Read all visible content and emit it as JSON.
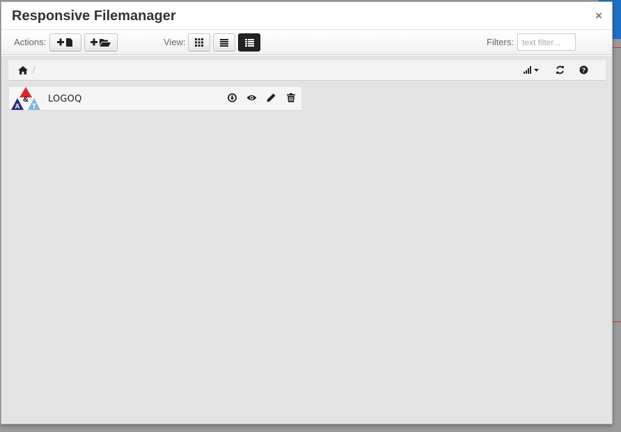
{
  "colors": {
    "header_bg": "#ffffff",
    "content_bg": "#e3e3e3",
    "active_view_btn": "#222222",
    "backdrop": "#9a9a9a"
  },
  "modal": {
    "title": "Responsive Filemanager",
    "close_glyph": "×"
  },
  "toolbar": {
    "actions_label": "Actions:",
    "view_label": "View:",
    "filters_label": "Filters:",
    "filter_placeholder": "text filter...",
    "buttons": {
      "upload_file": "plus-file-icon",
      "new_folder": "plus-folder-icon",
      "view_boxes": "grid-icon",
      "view_list": "list-icon",
      "view_columns": "columns-list-icon"
    },
    "active_view": "columns-list"
  },
  "breadcrumb": {
    "home_icon": "home-icon",
    "separator": "/",
    "sort_icon": "signal-sort-icon",
    "refresh_icon": "refresh-icon",
    "help_icon": "help-icon"
  },
  "files": [
    {
      "name": "LOGOQ",
      "thumb_letters": [
        "A",
        "&",
        "T"
      ],
      "actions": [
        "download-icon",
        "preview-eye-icon",
        "rename-pencil-icon",
        "delete-trash-icon"
      ]
    }
  ]
}
